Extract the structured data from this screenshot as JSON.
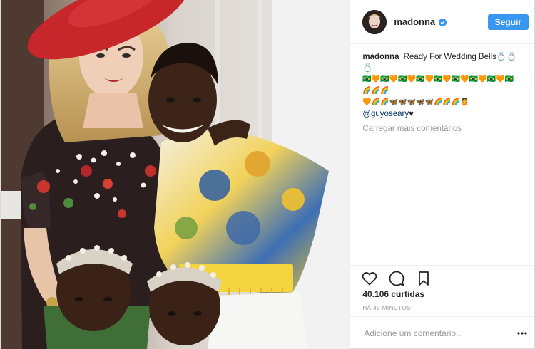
{
  "post": {
    "username": "madonna",
    "follow_label": "Seguir",
    "caption_user": "madonna",
    "caption_text": "Ready For Wedding Bells💍💍💍",
    "caption_emoji_line_1": "🇧🇷🧡🇧🇷🧡🇧🇷🧡🇧🇷🧡🇧🇷🧡🇧🇷🧡🇧🇷🧡🇧🇷🧡🇧🇷🌈🌈🌈",
    "caption_emoji_line_2": "🧡🌈🌈🦋🦋🦋🦋🦋🌈🌈🌈🙎",
    "caption_mention": "@guyoseary",
    "caption_mention_suffix": "♥",
    "load_more_label": "Carregar mais comentários",
    "likes": "40.106 curtidas",
    "time_ago": "HÁ 43 MINUTOS",
    "comment_placeholder": "Adicione um comentário..."
  },
  "icons": {
    "verified": "verified-badge-icon",
    "like": "heart-icon",
    "comment": "comment-bubble-icon",
    "save": "bookmark-icon",
    "more": "ellipsis-icon"
  },
  "colors": {
    "accent": "#3897f0",
    "mention": "#003569",
    "muted": "#999999"
  }
}
